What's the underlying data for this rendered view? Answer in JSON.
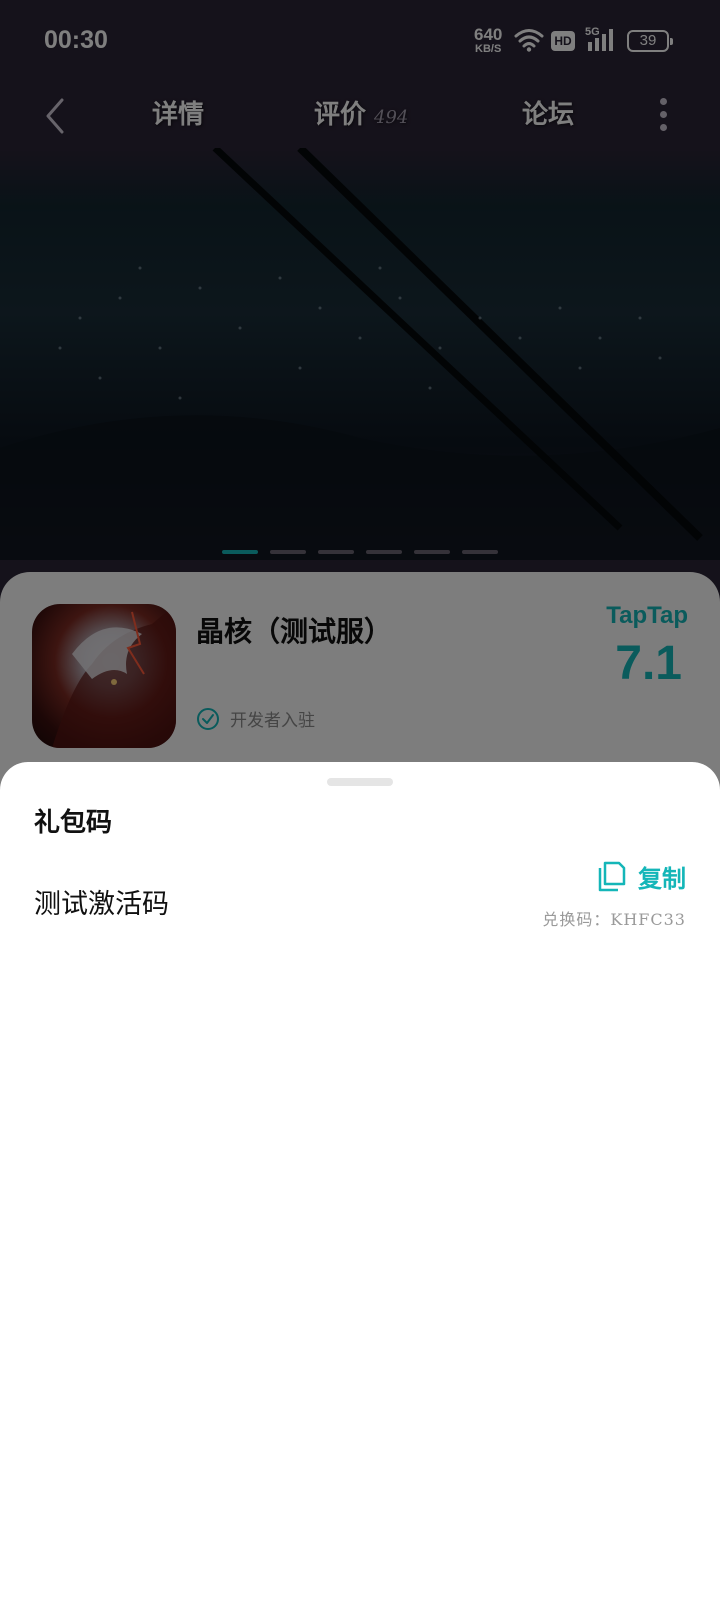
{
  "status_bar": {
    "time": "00:30",
    "net_speed": "640",
    "net_unit": "KB/S",
    "hd": "HD",
    "network": "5G",
    "battery": "39"
  },
  "nav": {
    "tab_details": "详情",
    "tab_reviews": "评价",
    "reviews_count": "494",
    "tab_forum": "论坛"
  },
  "carousel": {
    "total": 6,
    "active_index": 0
  },
  "app": {
    "title": "晶核（测试服）",
    "developer_badge": "开发者入驻",
    "brand": "TapTap",
    "score": "7.1"
  },
  "sheet": {
    "title": "礼包码",
    "items": [
      {
        "name": "测试激活码",
        "copy_label": "复制",
        "code_text": "兑换码：KHFC33"
      }
    ]
  },
  "colors": {
    "accent": "#14b6b8",
    "page_bg": "#2b2436"
  }
}
